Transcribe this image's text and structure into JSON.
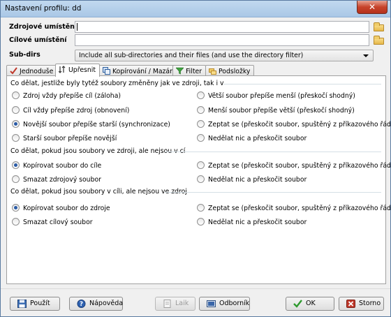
{
  "window": {
    "title": "Nastavení profilu: dd",
    "close_symbol": "✕"
  },
  "form": {
    "source_label": "Zdrojové umístění",
    "source_value": "",
    "target_label": "Cílové umístění",
    "target_value": "",
    "subdirs_label": "Sub-dirs",
    "subdirs_value": "Include all sub-directories and their files (and use the directory filter)"
  },
  "tabs": [
    {
      "label": "Jednoduše",
      "icon": "check-icon"
    },
    {
      "label": "Upřesnit",
      "icon": "sort-icon"
    },
    {
      "label": "Kopírování / Mazání",
      "icon": "copy-icon"
    },
    {
      "label": "Filter",
      "icon": "filter-icon"
    },
    {
      "label": "Podsložky",
      "icon": "folders-icon"
    }
  ],
  "active_tab": 1,
  "groups": [
    {
      "title": "Co dělat, jestliže byly tytéž soubory změněny jak ve zdroji, tak i v",
      "options": [
        {
          "label": "Zdroj vždy přepíše cíl (záloha)",
          "selected": false
        },
        {
          "label": "Větší soubor přepíše menší (přeskočí shodný)",
          "selected": false
        },
        {
          "label": "Cíl vždy přepíše zdroj (obnovení)",
          "selected": false
        },
        {
          "label": "Menší soubor přepíše větší (přeskočí shodný)",
          "selected": false
        },
        {
          "label": "Novější soubor přepíše starší (synchronizace)",
          "selected": true
        },
        {
          "label": "Zeptat se (přeskočit soubor, spuštěný z příkazového řádku)",
          "selected": false
        },
        {
          "label": "Starší soubor přepíše novější",
          "selected": false
        },
        {
          "label": "Nedělat nic a přeskočit soubor",
          "selected": false
        }
      ]
    },
    {
      "title": "Co dělat, pokud jsou soubory ve zdroji, ale nejsou v cí",
      "options": [
        {
          "label": "Kopírovat soubor do cíle",
          "selected": true
        },
        {
          "label": "Zeptat se (přeskočit soubor, spuštěný z příkazového řádku)",
          "selected": false
        },
        {
          "label": "Smazat zdrojový soubor",
          "selected": false
        },
        {
          "label": "Nedělat nic a přeskočit soubor",
          "selected": false
        }
      ]
    },
    {
      "title": "Co dělat, pokud jsou soubory v cíli, ale nejsou ve zdroj",
      "options": [
        {
          "label": "Kopírovat soubor do zdroje",
          "selected": true
        },
        {
          "label": "Zeptat se (přeskočit soubor, spuštěný z příkazového řádku)",
          "selected": false
        },
        {
          "label": "Smazat cílový soubor",
          "selected": false
        },
        {
          "label": "Nedělat nic a přeskočit soubor",
          "selected": false
        }
      ]
    }
  ],
  "buttons": {
    "apply": "Použít",
    "help": "Nápověda",
    "like": "Laik",
    "expert": "Odborník",
    "ok": "OK",
    "cancel": "Storno"
  },
  "colors": {
    "accent": "#2a5ba6",
    "title_bar": "#b9d3ec",
    "close": "#c7432b"
  }
}
